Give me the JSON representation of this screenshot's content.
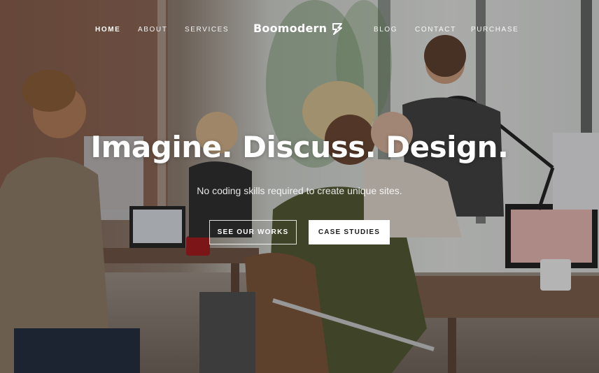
{
  "nav": {
    "left": [
      {
        "label": "HOME",
        "active": true
      },
      {
        "label": "ABOUT",
        "active": false
      },
      {
        "label": "SERVICES",
        "active": false
      }
    ],
    "right": [
      {
        "label": "BLOG",
        "active": false
      },
      {
        "label": "CONTACT",
        "active": false
      },
      {
        "label": "PURCHASE",
        "active": false
      }
    ],
    "logo": {
      "text": "Boomodern",
      "icon": "lightning-bolt-icon"
    }
  },
  "hero": {
    "headline": "Imagine. Discuss. Design.",
    "subline": "No coding skills required to create unique sites.",
    "primary_button": "SEE OUR WORKS",
    "secondary_button": "CASE STUDIES",
    "background": "office-coworkers-photo"
  },
  "colors": {
    "text": "#ffffff",
    "button_solid_bg": "#ffffff",
    "button_solid_text": "#1b1b1b"
  }
}
